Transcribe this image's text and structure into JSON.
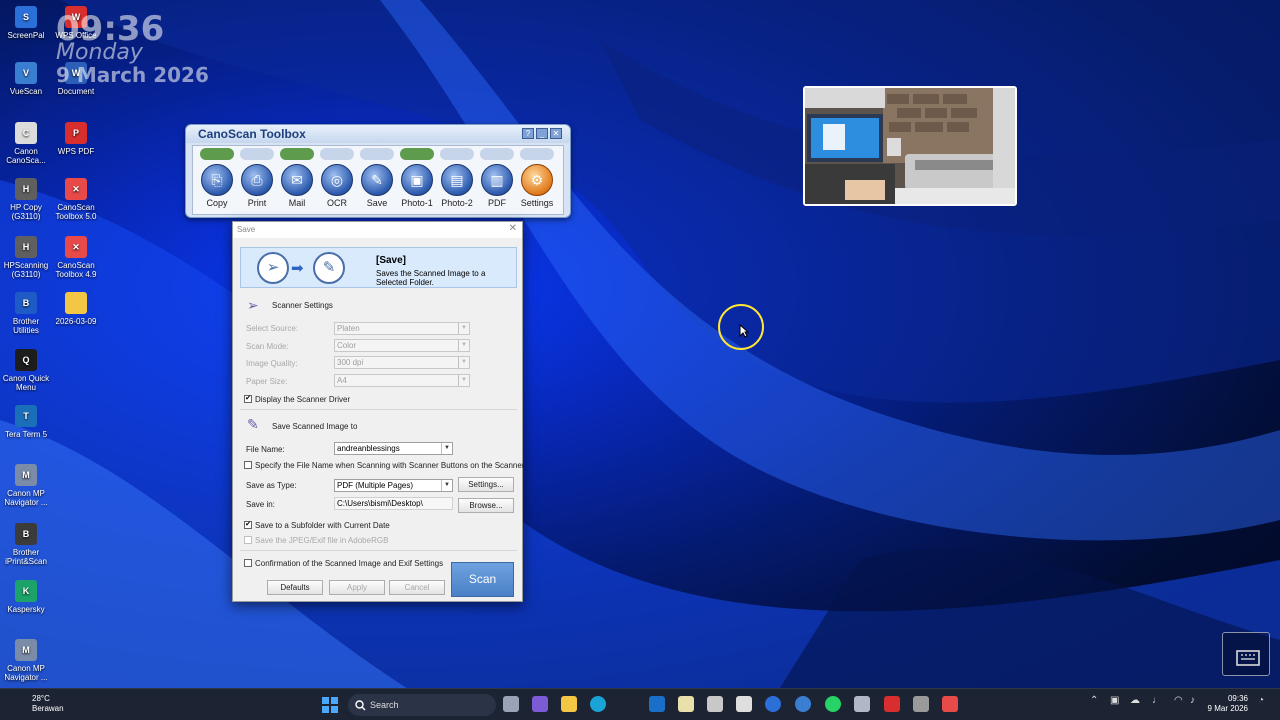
{
  "desktop": {
    "icons": [
      {
        "label": "ScreenPal",
        "color": "#2b6fd8",
        "glyph": "S"
      },
      {
        "label": "VueScan",
        "color": "#3a7ed1",
        "glyph": "V"
      },
      {
        "label": "Canon CanoSca...",
        "color": "#dcdcdc",
        "glyph": "C"
      },
      {
        "label": "HP Copy (G3110)",
        "color": "#5f5f5f",
        "glyph": "H"
      },
      {
        "label": "HPScanning (G3110)",
        "color": "#5f5f5f",
        "glyph": "H"
      },
      {
        "label": "Brother Utilities",
        "color": "#1e5bc6",
        "glyph": "B"
      },
      {
        "label": "Canon Quick Menu",
        "color": "#1d1d1d",
        "glyph": "Q"
      },
      {
        "label": "Tera Term 5",
        "color": "#1a6fb8",
        "glyph": "T"
      },
      {
        "label": "Canon MP Navigator ...",
        "color": "#7a8ca8",
        "glyph": "M"
      },
      {
        "label": "Brother iPrint&Scan",
        "color": "#3b3b3b",
        "glyph": "B"
      },
      {
        "label": "Kaspersky",
        "color": "#1ca36a",
        "glyph": "K"
      },
      {
        "label": "Canon MP Navigator ...",
        "color": "#7a8ca8",
        "glyph": "M"
      }
    ],
    "icons2": [
      {
        "label": "WPS Office",
        "color": "#d82e2e",
        "glyph": "W"
      },
      {
        "label": "Document",
        "color": "#2b5fb8",
        "glyph": "W"
      },
      {
        "label": "WPS PDF",
        "color": "#d82e2e",
        "glyph": "P"
      },
      {
        "label": "CanoScan Toolbox 5.0",
        "color": "#e84a4a",
        "glyph": "✕"
      },
      {
        "label": "CanoScan Toolbox 4.9",
        "color": "#e84a4a",
        "glyph": "✕"
      },
      {
        "label": "2026-03-09",
        "color": "#f3c743",
        "glyph": ""
      }
    ]
  },
  "clock_widget": {
    "time": "09:36",
    "day": "Monday",
    "date": "9 March 2026"
  },
  "toolbox": {
    "title": "CanoScan Toolbox",
    "controls": [
      "?",
      "_",
      "✕"
    ],
    "buttons": [
      {
        "label": "Copy",
        "pill_on": true
      },
      {
        "label": "Print",
        "pill_on": false
      },
      {
        "label": "Mail",
        "pill_on": true
      },
      {
        "label": "OCR",
        "pill_on": false
      },
      {
        "label": "Save",
        "pill_on": false
      },
      {
        "label": "Photo-1",
        "pill_on": true
      },
      {
        "label": "Photo-2",
        "pill_on": false
      },
      {
        "label": "PDF",
        "pill_on": false
      },
      {
        "label": "Settings",
        "pill_on": false
      }
    ]
  },
  "save_dialog": {
    "title": "Save",
    "header_title": "[Save]",
    "header_sub": "Saves the Scanned Image to a Selected Folder.",
    "scanner_settings_label": "Scanner Settings",
    "select_source_label": "Select Source:",
    "select_source_value": "Platen",
    "scan_mode_label": "Scan Mode:",
    "scan_mode_value": "Color",
    "image_quality_label": "Image Quality:",
    "image_quality_value": "300 dpi",
    "paper_size_label": "Paper Size:",
    "paper_size_value": "A4",
    "display_driver_label": "Display the Scanner Driver",
    "save_to_label": "Save Scanned Image to",
    "file_name_label": "File Name:",
    "file_name_value": "andreanblessings",
    "specify_label": "Specify the File Name when Scanning with Scanner Buttons on the Scanner",
    "save_type_label": "Save as Type:",
    "save_type_value": "PDF (Multiple Pages)",
    "settings_button": "Settings...",
    "save_in_label": "Save in:",
    "save_in_value": "C:\\Users\\bismi\\Desktop\\",
    "browse_button": "Browse...",
    "subfolder_label": "Save to a Subfolder with Current Date",
    "adobergb_label": "Save the JPEG/Exif file in AdobeRGB",
    "confirm_label": "Confirmation of the Scanned Image and Exif Settings",
    "defaults_button": "Defaults",
    "apply_button": "Apply",
    "cancel_button": "Cancel",
    "scan_button": "Scan"
  },
  "taskbar": {
    "temperature": "28°C",
    "weather": "Berawan",
    "search_placeholder": "Search",
    "time": "09:36",
    "date": "9 Mar 2026"
  }
}
